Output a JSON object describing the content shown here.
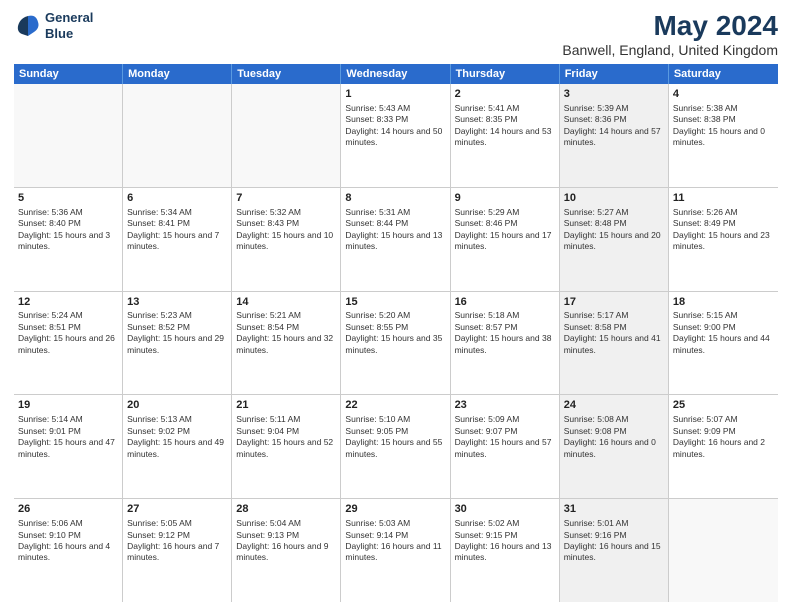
{
  "logo": {
    "line1": "General",
    "line2": "Blue"
  },
  "title": "May 2024",
  "subtitle": "Banwell, England, United Kingdom",
  "days_of_week": [
    "Sunday",
    "Monday",
    "Tuesday",
    "Wednesday",
    "Thursday",
    "Friday",
    "Saturday"
  ],
  "weeks": [
    [
      {
        "day": "",
        "info": "",
        "shaded": false,
        "empty": true
      },
      {
        "day": "",
        "info": "",
        "shaded": false,
        "empty": true
      },
      {
        "day": "",
        "info": "",
        "shaded": false,
        "empty": true
      },
      {
        "day": "1",
        "sunrise": "Sunrise: 5:43 AM",
        "sunset": "Sunset: 8:33 PM",
        "daylight": "Daylight: 14 hours and 50 minutes.",
        "shaded": false,
        "empty": false
      },
      {
        "day": "2",
        "sunrise": "Sunrise: 5:41 AM",
        "sunset": "Sunset: 8:35 PM",
        "daylight": "Daylight: 14 hours and 53 minutes.",
        "shaded": false,
        "empty": false
      },
      {
        "day": "3",
        "sunrise": "Sunrise: 5:39 AM",
        "sunset": "Sunset: 8:36 PM",
        "daylight": "Daylight: 14 hours and 57 minutes.",
        "shaded": true,
        "empty": false
      },
      {
        "day": "4",
        "sunrise": "Sunrise: 5:38 AM",
        "sunset": "Sunset: 8:38 PM",
        "daylight": "Daylight: 15 hours and 0 minutes.",
        "shaded": false,
        "empty": false
      }
    ],
    [
      {
        "day": "5",
        "sunrise": "Sunrise: 5:36 AM",
        "sunset": "Sunset: 8:40 PM",
        "daylight": "Daylight: 15 hours and 3 minutes.",
        "shaded": false,
        "empty": false
      },
      {
        "day": "6",
        "sunrise": "Sunrise: 5:34 AM",
        "sunset": "Sunset: 8:41 PM",
        "daylight": "Daylight: 15 hours and 7 minutes.",
        "shaded": false,
        "empty": false
      },
      {
        "day": "7",
        "sunrise": "Sunrise: 5:32 AM",
        "sunset": "Sunset: 8:43 PM",
        "daylight": "Daylight: 15 hours and 10 minutes.",
        "shaded": false,
        "empty": false
      },
      {
        "day": "8",
        "sunrise": "Sunrise: 5:31 AM",
        "sunset": "Sunset: 8:44 PM",
        "daylight": "Daylight: 15 hours and 13 minutes.",
        "shaded": false,
        "empty": false
      },
      {
        "day": "9",
        "sunrise": "Sunrise: 5:29 AM",
        "sunset": "Sunset: 8:46 PM",
        "daylight": "Daylight: 15 hours and 17 minutes.",
        "shaded": false,
        "empty": false
      },
      {
        "day": "10",
        "sunrise": "Sunrise: 5:27 AM",
        "sunset": "Sunset: 8:48 PM",
        "daylight": "Daylight: 15 hours and 20 minutes.",
        "shaded": true,
        "empty": false
      },
      {
        "day": "11",
        "sunrise": "Sunrise: 5:26 AM",
        "sunset": "Sunset: 8:49 PM",
        "daylight": "Daylight: 15 hours and 23 minutes.",
        "shaded": false,
        "empty": false
      }
    ],
    [
      {
        "day": "12",
        "sunrise": "Sunrise: 5:24 AM",
        "sunset": "Sunset: 8:51 PM",
        "daylight": "Daylight: 15 hours and 26 minutes.",
        "shaded": false,
        "empty": false
      },
      {
        "day": "13",
        "sunrise": "Sunrise: 5:23 AM",
        "sunset": "Sunset: 8:52 PM",
        "daylight": "Daylight: 15 hours and 29 minutes.",
        "shaded": false,
        "empty": false
      },
      {
        "day": "14",
        "sunrise": "Sunrise: 5:21 AM",
        "sunset": "Sunset: 8:54 PM",
        "daylight": "Daylight: 15 hours and 32 minutes.",
        "shaded": false,
        "empty": false
      },
      {
        "day": "15",
        "sunrise": "Sunrise: 5:20 AM",
        "sunset": "Sunset: 8:55 PM",
        "daylight": "Daylight: 15 hours and 35 minutes.",
        "shaded": false,
        "empty": false
      },
      {
        "day": "16",
        "sunrise": "Sunrise: 5:18 AM",
        "sunset": "Sunset: 8:57 PM",
        "daylight": "Daylight: 15 hours and 38 minutes.",
        "shaded": false,
        "empty": false
      },
      {
        "day": "17",
        "sunrise": "Sunrise: 5:17 AM",
        "sunset": "Sunset: 8:58 PM",
        "daylight": "Daylight: 15 hours and 41 minutes.",
        "shaded": true,
        "empty": false
      },
      {
        "day": "18",
        "sunrise": "Sunrise: 5:15 AM",
        "sunset": "Sunset: 9:00 PM",
        "daylight": "Daylight: 15 hours and 44 minutes.",
        "shaded": false,
        "empty": false
      }
    ],
    [
      {
        "day": "19",
        "sunrise": "Sunrise: 5:14 AM",
        "sunset": "Sunset: 9:01 PM",
        "daylight": "Daylight: 15 hours and 47 minutes.",
        "shaded": false,
        "empty": false
      },
      {
        "day": "20",
        "sunrise": "Sunrise: 5:13 AM",
        "sunset": "Sunset: 9:02 PM",
        "daylight": "Daylight: 15 hours and 49 minutes.",
        "shaded": false,
        "empty": false
      },
      {
        "day": "21",
        "sunrise": "Sunrise: 5:11 AM",
        "sunset": "Sunset: 9:04 PM",
        "daylight": "Daylight: 15 hours and 52 minutes.",
        "shaded": false,
        "empty": false
      },
      {
        "day": "22",
        "sunrise": "Sunrise: 5:10 AM",
        "sunset": "Sunset: 9:05 PM",
        "daylight": "Daylight: 15 hours and 55 minutes.",
        "shaded": false,
        "empty": false
      },
      {
        "day": "23",
        "sunrise": "Sunrise: 5:09 AM",
        "sunset": "Sunset: 9:07 PM",
        "daylight": "Daylight: 15 hours and 57 minutes.",
        "shaded": false,
        "empty": false
      },
      {
        "day": "24",
        "sunrise": "Sunrise: 5:08 AM",
        "sunset": "Sunset: 9:08 PM",
        "daylight": "Daylight: 16 hours and 0 minutes.",
        "shaded": true,
        "empty": false
      },
      {
        "day": "25",
        "sunrise": "Sunrise: 5:07 AM",
        "sunset": "Sunset: 9:09 PM",
        "daylight": "Daylight: 16 hours and 2 minutes.",
        "shaded": false,
        "empty": false
      }
    ],
    [
      {
        "day": "26",
        "sunrise": "Sunrise: 5:06 AM",
        "sunset": "Sunset: 9:10 PM",
        "daylight": "Daylight: 16 hours and 4 minutes.",
        "shaded": false,
        "empty": false
      },
      {
        "day": "27",
        "sunrise": "Sunrise: 5:05 AM",
        "sunset": "Sunset: 9:12 PM",
        "daylight": "Daylight: 16 hours and 7 minutes.",
        "shaded": false,
        "empty": false
      },
      {
        "day": "28",
        "sunrise": "Sunrise: 5:04 AM",
        "sunset": "Sunset: 9:13 PM",
        "daylight": "Daylight: 16 hours and 9 minutes.",
        "shaded": false,
        "empty": false
      },
      {
        "day": "29",
        "sunrise": "Sunrise: 5:03 AM",
        "sunset": "Sunset: 9:14 PM",
        "daylight": "Daylight: 16 hours and 11 minutes.",
        "shaded": false,
        "empty": false
      },
      {
        "day": "30",
        "sunrise": "Sunrise: 5:02 AM",
        "sunset": "Sunset: 9:15 PM",
        "daylight": "Daylight: 16 hours and 13 minutes.",
        "shaded": false,
        "empty": false
      },
      {
        "day": "31",
        "sunrise": "Sunrise: 5:01 AM",
        "sunset": "Sunset: 9:16 PM",
        "daylight": "Daylight: 16 hours and 15 minutes.",
        "shaded": true,
        "empty": false
      },
      {
        "day": "",
        "info": "",
        "shaded": false,
        "empty": true
      }
    ]
  ]
}
